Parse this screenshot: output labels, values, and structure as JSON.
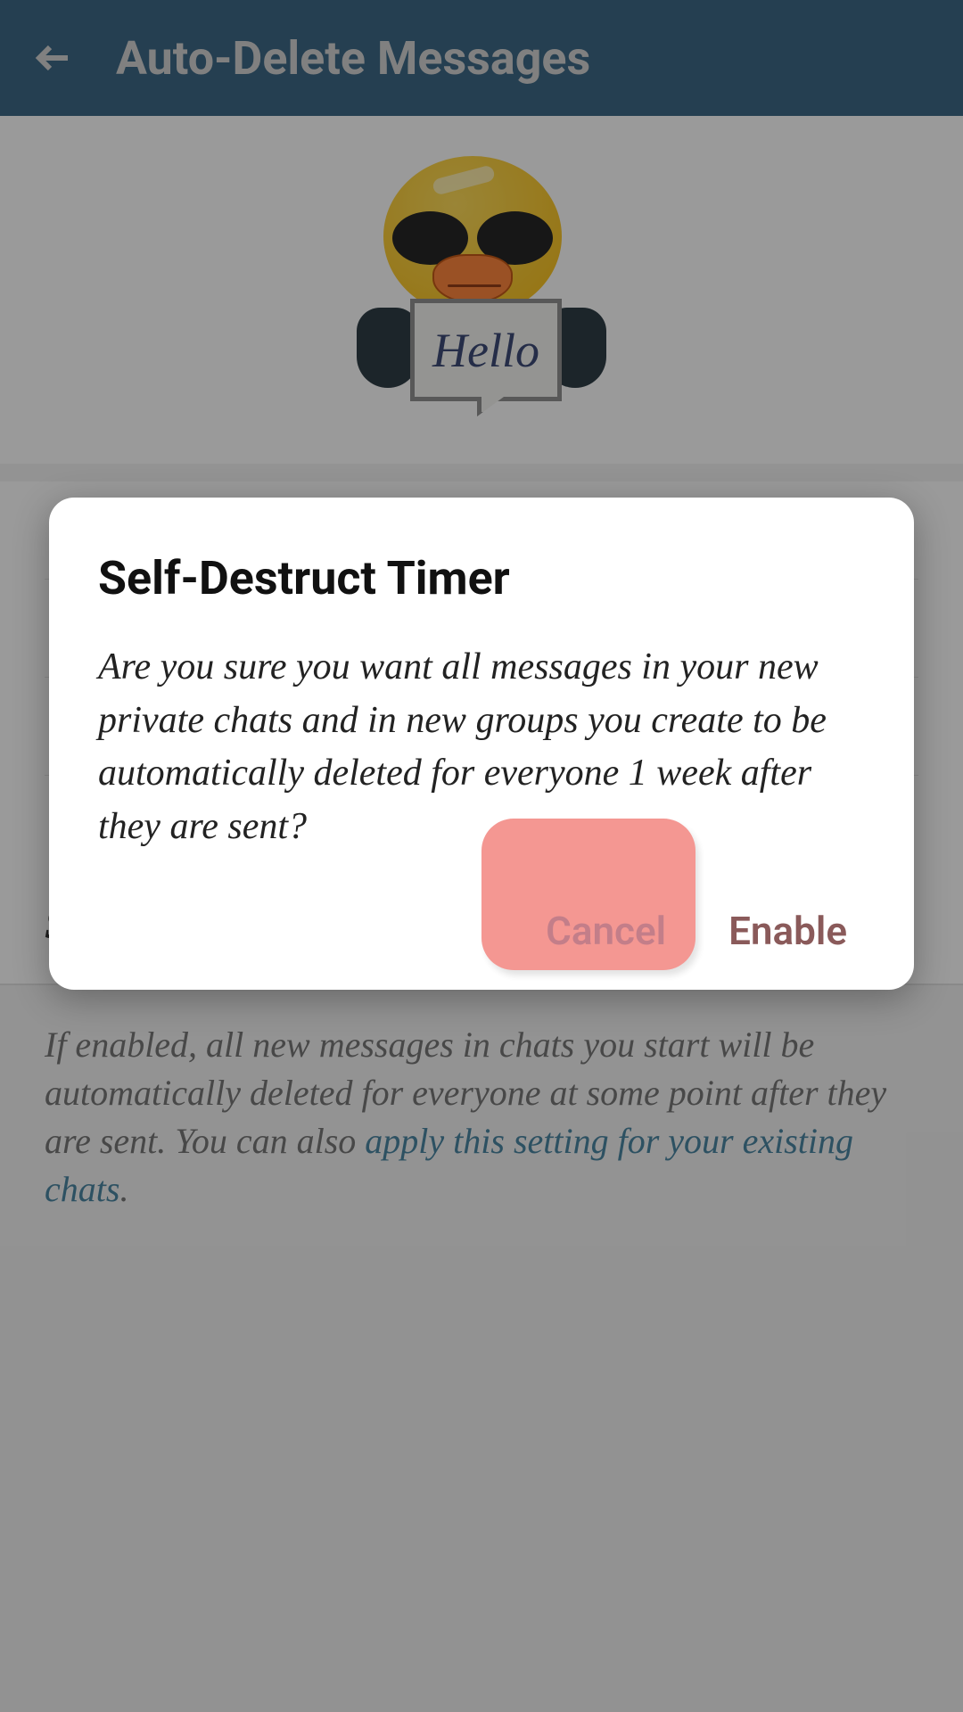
{
  "header": {
    "title": "Auto-Delete Messages"
  },
  "hero": {
    "sign_text": "Hello"
  },
  "options": {
    "set_custom_label": "Set Custom Time"
  },
  "footer": {
    "text_prefix": "If enabled, all new messages in chats you start will be automatically deleted for everyone at some point after they are sent. You can also ",
    "link_text": "apply this setting for your existing chats",
    "text_suffix": "."
  },
  "dialog": {
    "title": "Self-Destruct Timer",
    "body": "Are you sure you want all messages in your new private chats and in new groups you create to be automatically deleted for everyone 1 week after they are sent?",
    "cancel_label": "Cancel",
    "enable_label": "Enable"
  }
}
